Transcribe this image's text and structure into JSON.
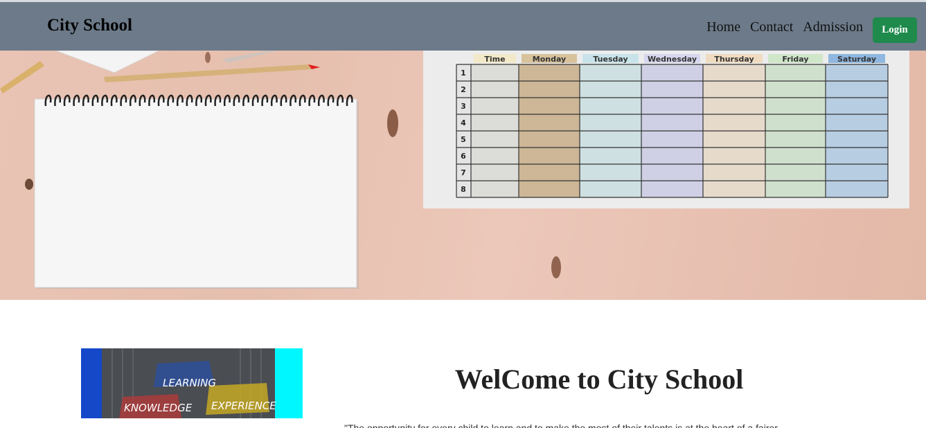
{
  "navbar": {
    "brand": "City School",
    "links": [
      "Home",
      "Contact",
      "Admission"
    ],
    "login_label": "Login"
  },
  "hero": {
    "timetable": {
      "headers": [
        "Time",
        "Monday",
        "Tuesday",
        "Wednesday",
        "Thursday",
        "Friday",
        "Saturday"
      ],
      "rows": [
        "1",
        "2",
        "3",
        "4",
        "5",
        "6",
        "7",
        "8"
      ]
    }
  },
  "feature_image": {
    "words": [
      "LEARNING",
      "KNOWLEDGE",
      "EXPERIENCE"
    ]
  },
  "main": {
    "welcome_title": "WelCome to City School",
    "quote": "\"The opportunity for every child to learn and to make the most of their talents is at the heart of a fairer"
  }
}
